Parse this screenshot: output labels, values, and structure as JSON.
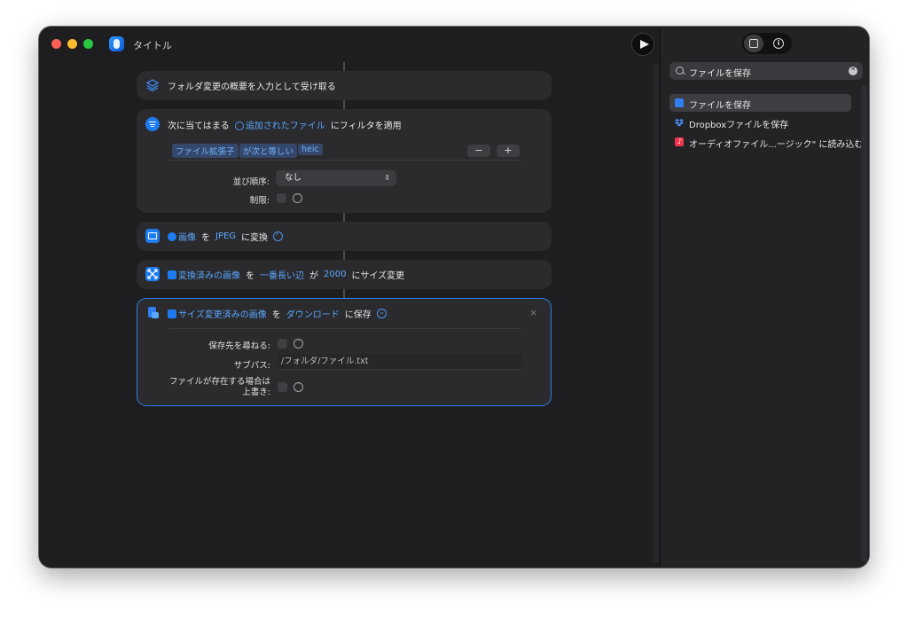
{
  "window": {
    "title": "タイトル"
  },
  "actions": {
    "a1": {
      "text": "フォルダ変更の概要を入力として受け取る"
    },
    "a2": {
      "prefix": "次に当てはまる",
      "input_token": "追加されたファイル",
      "suffix": "にフィルタを適用",
      "filter": {
        "field": "ファイル拡張子",
        "op": "が次と等しい",
        "value": "heic"
      },
      "minus_label": "−",
      "plus_label": "+",
      "sort_label": "並び順序:",
      "sort_value": "なし",
      "limit_label": "制限:"
    },
    "a3": {
      "token1": "画像",
      "word1": "を",
      "token2": "JPEG",
      "word2": "に変換"
    },
    "a4": {
      "token1": "変換済みの画像",
      "word1": "を",
      "token2": "一番長い辺",
      "word2": "が",
      "token3": "2000",
      "word3": "にサイズ変更"
    },
    "a5": {
      "token1": "サイズ変更済みの画像",
      "word1": "を",
      "token2": "ダウンロード",
      "word2": "に保存",
      "close_label": "×",
      "ask_label": "保存先を尋ねる:",
      "subpath_label": "サブパス:",
      "subpath_value": "/フォルダ/ファイル.txt",
      "overwrite_label_1": "ファイルが存在する場合は",
      "overwrite_label_2": "上書き:"
    }
  },
  "sidebar": {
    "search": {
      "value": "ファイルを保存"
    },
    "results": [
      {
        "label": "ファイルを保存",
        "icon": "save-file-icon",
        "color": "#2f7ff2"
      },
      {
        "label": "Dropboxファイルを保存",
        "icon": "dropbox-icon",
        "color": "#3b82f6"
      },
      {
        "label": "オーディオファイル...ージック\" に読み込む",
        "icon": "music-icon",
        "color": "#f2344a"
      }
    ]
  },
  "colors": {
    "accent": "#2b7de9",
    "token": "#5aa7ff"
  }
}
